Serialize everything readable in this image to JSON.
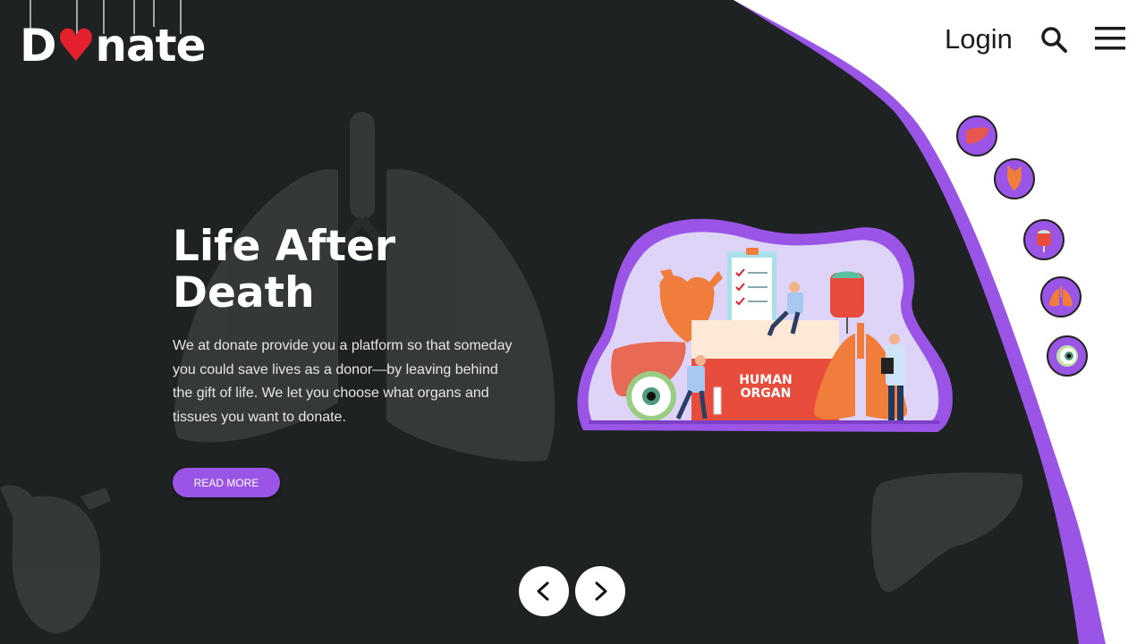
{
  "brand": {
    "logo_text_start": "D",
    "logo_heart": "♥",
    "logo_text_end": "nate"
  },
  "header": {
    "login_label": "Login",
    "search_icon": "search-icon",
    "menu_icon": "hamburger-menu-icon"
  },
  "hero": {
    "title_line1": "Life After",
    "title_line2": "Death",
    "description": "We at donate provide you a platform so that someday you could save lives as a donor—by leaving behind the gift of life. We let you choose what organs and tissues you want to donate.",
    "read_more_label": "READ MORE"
  },
  "illustration": {
    "box_label_line1": "HUMAN",
    "box_label_line2": "ORGAN"
  },
  "organ_icons": [
    "liver-icon",
    "heart-icon",
    "blood-bag-icon",
    "lungs-icon",
    "eye-icon"
  ],
  "slider": {
    "prev_icon": "chevron-left-icon",
    "next_icon": "chevron-right-icon"
  },
  "colors": {
    "background_dark": "#1f2222",
    "accent_purple": "#9b55e6",
    "white": "#ffffff",
    "heart_red": "#e3212d"
  }
}
